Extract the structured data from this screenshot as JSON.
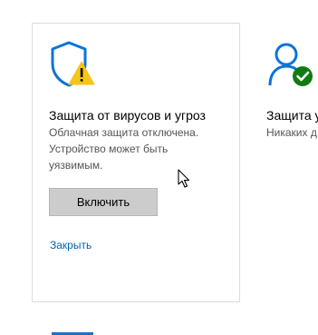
{
  "colors": {
    "accent": "#0063b1",
    "warning": "#f5c518",
    "ok": "#107c10",
    "icon_blue": "#0a74da"
  },
  "card_virus": {
    "icon": "shield-warning-icon",
    "title": "Защита от вирусов и угроз",
    "description_lines": [
      "Облачная защита отключена.",
      "Устройство может быть",
      "уязвимым."
    ],
    "enable_label": "Включить",
    "close_label": "Закрыть"
  },
  "card_account": {
    "icon": "account-check-icon",
    "title": "Защита у",
    "description": "Никаких д"
  }
}
